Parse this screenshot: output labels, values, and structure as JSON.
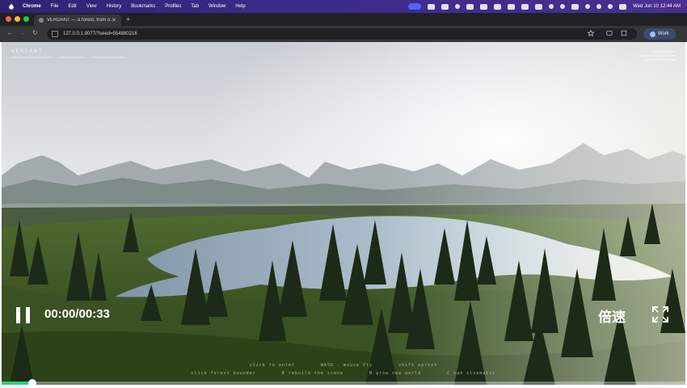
{
  "menubar": {
    "items": [
      "Chrome",
      "File",
      "Edit",
      "View",
      "History",
      "Bookmarks",
      "Profiles",
      "Tab",
      "Window",
      "Help"
    ],
    "datetime": "Wed Jun 10  12:44 AM"
  },
  "browser": {
    "tab_title": "VERDANT — a forest, from o...",
    "url": "127.0.0.1:8077/?seed=554880216",
    "profile_label": "Work"
  },
  "game": {
    "title": "VERDANT",
    "help_line1": [
      "click to enter",
      "WASD · mouse fly",
      "shift sprint"
    ],
    "help_line2": [
      "click forest bounder",
      "R rebuild the scene",
      "N grow new world",
      "C cam cinematic"
    ]
  },
  "player": {
    "time": "00:00/00:33",
    "speed_label": "倍速",
    "progress": 0.045
  }
}
